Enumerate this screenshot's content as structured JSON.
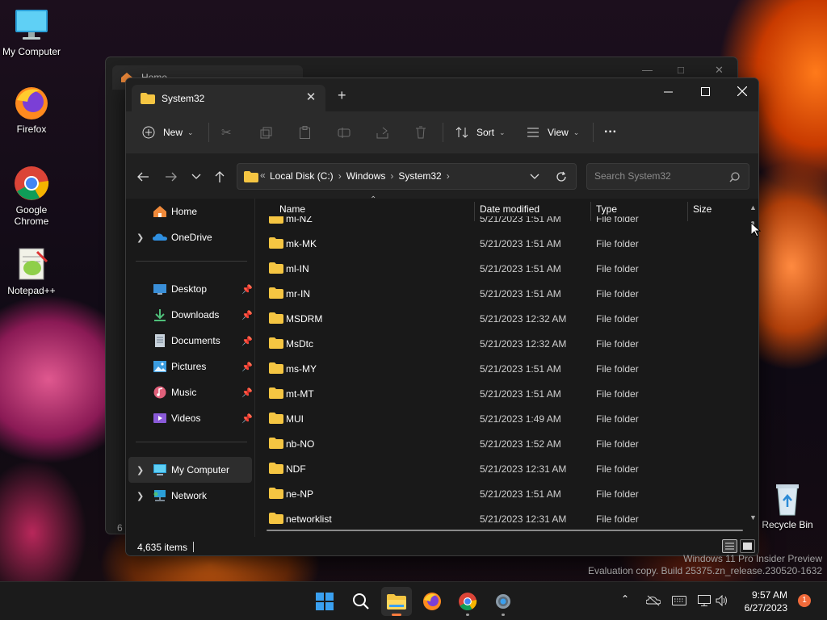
{
  "desktop": {
    "icons": [
      {
        "label": "My Computer",
        "icon": "monitor-icon"
      },
      {
        "label": "Firefox",
        "icon": "firefox-icon"
      },
      {
        "label": "Google Chrome",
        "icon": "chrome-icon"
      },
      {
        "label": "Notepad++",
        "icon": "notepadpp-icon"
      },
      {
        "label": "Recycle Bin",
        "icon": "recycle-bin-icon"
      }
    ],
    "watermark": {
      "line1": "Windows 11 Pro Insider Preview",
      "line2": "Evaluation copy. Build 25375.zn_release.230520-1632"
    }
  },
  "back_window": {
    "tab_title": "Home",
    "status_fragment": "6 i"
  },
  "window": {
    "tab_title": "System32",
    "new_tab": "+",
    "toolbar": {
      "new_label": "New",
      "sort_label": "Sort",
      "view_label": "View",
      "more_label": "···"
    },
    "address": {
      "overflow": "«",
      "crumbs": [
        "Local Disk (C:)",
        "Windows",
        "System32"
      ],
      "separator": "›"
    },
    "search": {
      "placeholder": "Search System32"
    },
    "sidebar": {
      "items": [
        {
          "label": "Home",
          "icon": "home-icon"
        },
        {
          "label": "OneDrive",
          "icon": "onedrive-icon"
        },
        {
          "label": "Desktop",
          "icon": "desktop-folder-icon",
          "pinned": true
        },
        {
          "label": "Downloads",
          "icon": "downloads-icon",
          "pinned": true
        },
        {
          "label": "Documents",
          "icon": "documents-icon",
          "pinned": true
        },
        {
          "label": "Pictures",
          "icon": "pictures-icon",
          "pinned": true
        },
        {
          "label": "Music",
          "icon": "music-icon",
          "pinned": true
        },
        {
          "label": "Videos",
          "icon": "videos-icon",
          "pinned": true
        },
        {
          "label": "My Computer",
          "icon": "monitor-icon",
          "selected": true
        },
        {
          "label": "Network",
          "icon": "network-icon"
        }
      ]
    },
    "columns": [
      "Name",
      "Date modified",
      "Type",
      "Size"
    ],
    "rows": [
      {
        "name": "mi-NZ",
        "date": "5/21/2023 1:51 AM",
        "type": "File folder"
      },
      {
        "name": "mk-MK",
        "date": "5/21/2023 1:51 AM",
        "type": "File folder"
      },
      {
        "name": "ml-IN",
        "date": "5/21/2023 1:51 AM",
        "type": "File folder"
      },
      {
        "name": "mr-IN",
        "date": "5/21/2023 1:51 AM",
        "type": "File folder"
      },
      {
        "name": "MSDRM",
        "date": "5/21/2023 12:32 AM",
        "type": "File folder"
      },
      {
        "name": "MsDtc",
        "date": "5/21/2023 12:32 AM",
        "type": "File folder"
      },
      {
        "name": "ms-MY",
        "date": "5/21/2023 1:51 AM",
        "type": "File folder"
      },
      {
        "name": "mt-MT",
        "date": "5/21/2023 1:51 AM",
        "type": "File folder"
      },
      {
        "name": "MUI",
        "date": "5/21/2023 1:49 AM",
        "type": "File folder"
      },
      {
        "name": "nb-NO",
        "date": "5/21/2023 1:52 AM",
        "type": "File folder"
      },
      {
        "name": "NDF",
        "date": "5/21/2023 12:31 AM",
        "type": "File folder"
      },
      {
        "name": "ne-NP",
        "date": "5/21/2023 1:51 AM",
        "type": "File folder"
      },
      {
        "name": "networklist",
        "date": "5/21/2023 12:31 AM",
        "type": "File folder"
      }
    ],
    "status": {
      "item_count": "4,635 items"
    }
  },
  "taskbar": {
    "apps": [
      "start-icon",
      "search-icon",
      "file-explorer-icon",
      "firefox-icon",
      "chrome-icon",
      "settings-icon"
    ],
    "clock": {
      "time": "9:57 AM",
      "date": "6/27/2023"
    },
    "notification_count": "1"
  },
  "colors": {
    "accent": "#ff7b3d",
    "folder": "#f5c542",
    "window_bg": "#191919"
  }
}
